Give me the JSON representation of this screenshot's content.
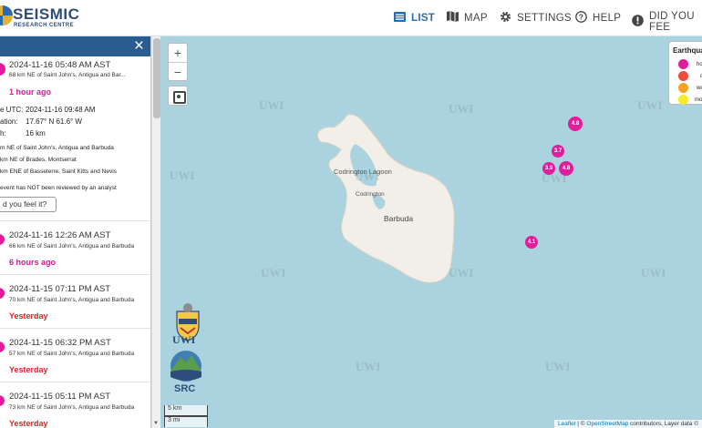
{
  "header": {
    "logo_title": "SEISMIC",
    "logo_subtitle": "RESEARCH CENTRE",
    "nav": [
      {
        "label": "LIST",
        "icon": "list-icon",
        "active": true
      },
      {
        "label": "MAP",
        "icon": "map-icon",
        "active": false
      },
      {
        "label": "SETTINGS",
        "icon": "gear-icon",
        "active": false
      },
      {
        "label": "HELP",
        "icon": "help-icon",
        "active": false
      },
      {
        "label": "DID YOU FEE",
        "icon": "alert-icon",
        "active": false
      }
    ]
  },
  "sidebar": {
    "close_icon": "×",
    "selected": {
      "time": "2024-11-16 05:48 AM AST",
      "location": "68 km NE of Saint John's, Antigua and Bar...",
      "relative": "1 hour ago",
      "utc_label": "e UTC:",
      "utc_value": "2024-11-16 09:48 AM",
      "loc_label": "ation:",
      "loc_value": "17.67° N 61.6° W",
      "depth_label": "h:",
      "depth_value": "16 km",
      "near1": "m NE of Saint John's, Antigua and Barbuda",
      "near2": "km NE of Brades, Montserrat",
      "near3": "km ENE of Basseterre, Saint Kitts and Nevis",
      "review": "event has NOT been reviewed by an analyst",
      "feel_button": "d you feel it?"
    },
    "events": [
      {
        "time": "2024-11-16 12:26 AM AST",
        "location": "66 km NE of Saint John's, Antigua and Barbuda",
        "relative": "6 hours ago"
      },
      {
        "time": "2024-11-15 07:11 PM AST",
        "location": "70 km NE of Saint John's, Antigua and Barbuda",
        "relative": "Yesterday"
      },
      {
        "time": "2024-11-15 06:32 PM AST",
        "location": "57 km NE of Saint John's, Antigua and Barbuda",
        "relative": "Yesterday"
      },
      {
        "time": "2024-11-15 05:11 PM AST",
        "location": "73 km NE of Saint John's, Antigua and Barbuda",
        "relative": "Yesterday"
      }
    ]
  },
  "map": {
    "zoom_in": "+",
    "zoom_out": "−",
    "labels": {
      "codrington_lagoon": "Codrington Lagoon",
      "codrington": "Codrington",
      "barbuda": "Barbuda"
    },
    "markers": [
      "4.8",
      "3.7",
      "3.9",
      "4.8",
      "4.1"
    ],
    "legend": {
      "title": "Earthquak",
      "items": [
        {
          "label": "ho",
          "color": "#e21c9b"
        },
        {
          "label": "d",
          "color": "#ef4a3b"
        },
        {
          "label": "we",
          "color": "#f7a225"
        },
        {
          "label": "mon",
          "color": "#f7ea2a"
        }
      ]
    },
    "scale_km": "5 km",
    "scale_mi": "3 mi",
    "attribution_leaflet": "Leaflet",
    "attribution_sep": " | © ",
    "attribution_osm": "OpenStreetMap",
    "attribution_rest": " contributors, Layer data ©",
    "watermark": "UWI",
    "uwi_logo": "UWI",
    "src_logo": "SRC"
  }
}
